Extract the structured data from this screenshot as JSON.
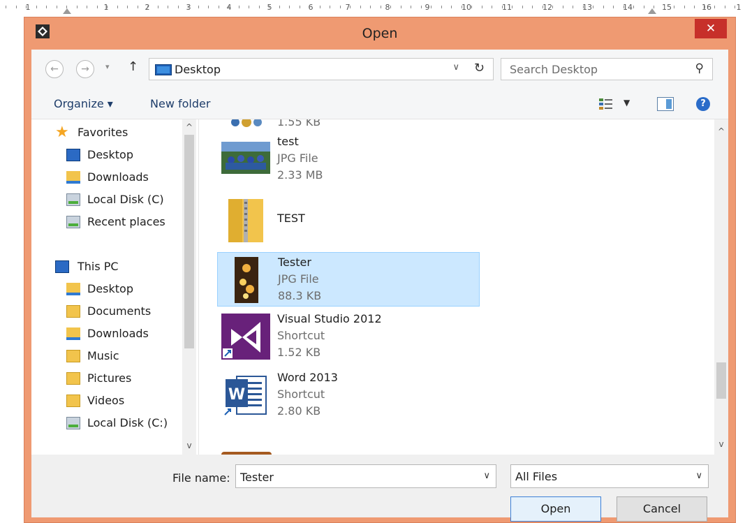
{
  "ruler": {
    "numbers": [
      "1",
      "1",
      "2",
      "3",
      "4",
      "5",
      "6",
      "7",
      "8",
      "9",
      "10",
      "11",
      "12",
      "13",
      "14",
      "15",
      "16",
      "1"
    ]
  },
  "window": {
    "title": "Open",
    "close_glyph": "✕"
  },
  "nav": {
    "back_glyph": "←",
    "forward_glyph": "→",
    "up_glyph": "↑",
    "address_text": "Desktop",
    "address_dropdown_glyph": "∨",
    "refresh_glyph": "↻",
    "search_placeholder": "Search Desktop",
    "search_glyph": "⚲"
  },
  "toolbar": {
    "organize_label": "Organize ▾",
    "new_folder_label": "New folder",
    "views_dropdown_glyph": "▼",
    "help_glyph": "?"
  },
  "sidebar": {
    "favorites_label": "Favorites",
    "favorites": [
      {
        "label": "Desktop",
        "icon": "desktop-icon"
      },
      {
        "label": "Downloads",
        "icon": "downloads-folder-icon"
      },
      {
        "label": "Local Disk (C)",
        "icon": "local-disk-icon"
      },
      {
        "label": "Recent places",
        "icon": "recent-places-icon"
      }
    ],
    "thispc_label": "This PC",
    "thispc": [
      {
        "label": "Desktop",
        "icon": "desktop-folder-icon"
      },
      {
        "label": "Documents",
        "icon": "documents-folder-icon"
      },
      {
        "label": "Downloads",
        "icon": "downloads-folder-icon"
      },
      {
        "label": "Music",
        "icon": "music-folder-icon"
      },
      {
        "label": "Pictures",
        "icon": "pictures-folder-icon"
      },
      {
        "label": "Videos",
        "icon": "videos-folder-icon"
      },
      {
        "label": "Local Disk (C:)",
        "icon": "local-disk-icon"
      }
    ]
  },
  "files": [
    {
      "name": "",
      "type": "",
      "size": "1.55 KB",
      "partial": true
    },
    {
      "name": "test",
      "type": "JPG File",
      "size": "2.33 MB",
      "icon": "photo-thumbnail"
    },
    {
      "name": "TEST",
      "type": "",
      "size": "",
      "icon": "zip-folder-icon"
    },
    {
      "name": "Tester",
      "type": "JPG File",
      "size": "88.3 KB",
      "icon": "photo-thumbnail",
      "selected": true
    },
    {
      "name": "Visual Studio 2012",
      "type": "Shortcut",
      "size": "1.52 KB",
      "icon": "visual-studio-icon"
    },
    {
      "name": "Word 2013",
      "type": "Shortcut",
      "size": "2.80 KB",
      "icon": "word-icon"
    }
  ],
  "bottom": {
    "filename_label": "File name:",
    "filename_value": "Tester",
    "filter_value": "All Files",
    "open_label": "Open",
    "cancel_label": "Cancel"
  },
  "colors": {
    "title_bar": "#ef9a72",
    "close_button": "#c7302a",
    "selection": "#cce8ff",
    "selection_border": "#99d1ff"
  }
}
